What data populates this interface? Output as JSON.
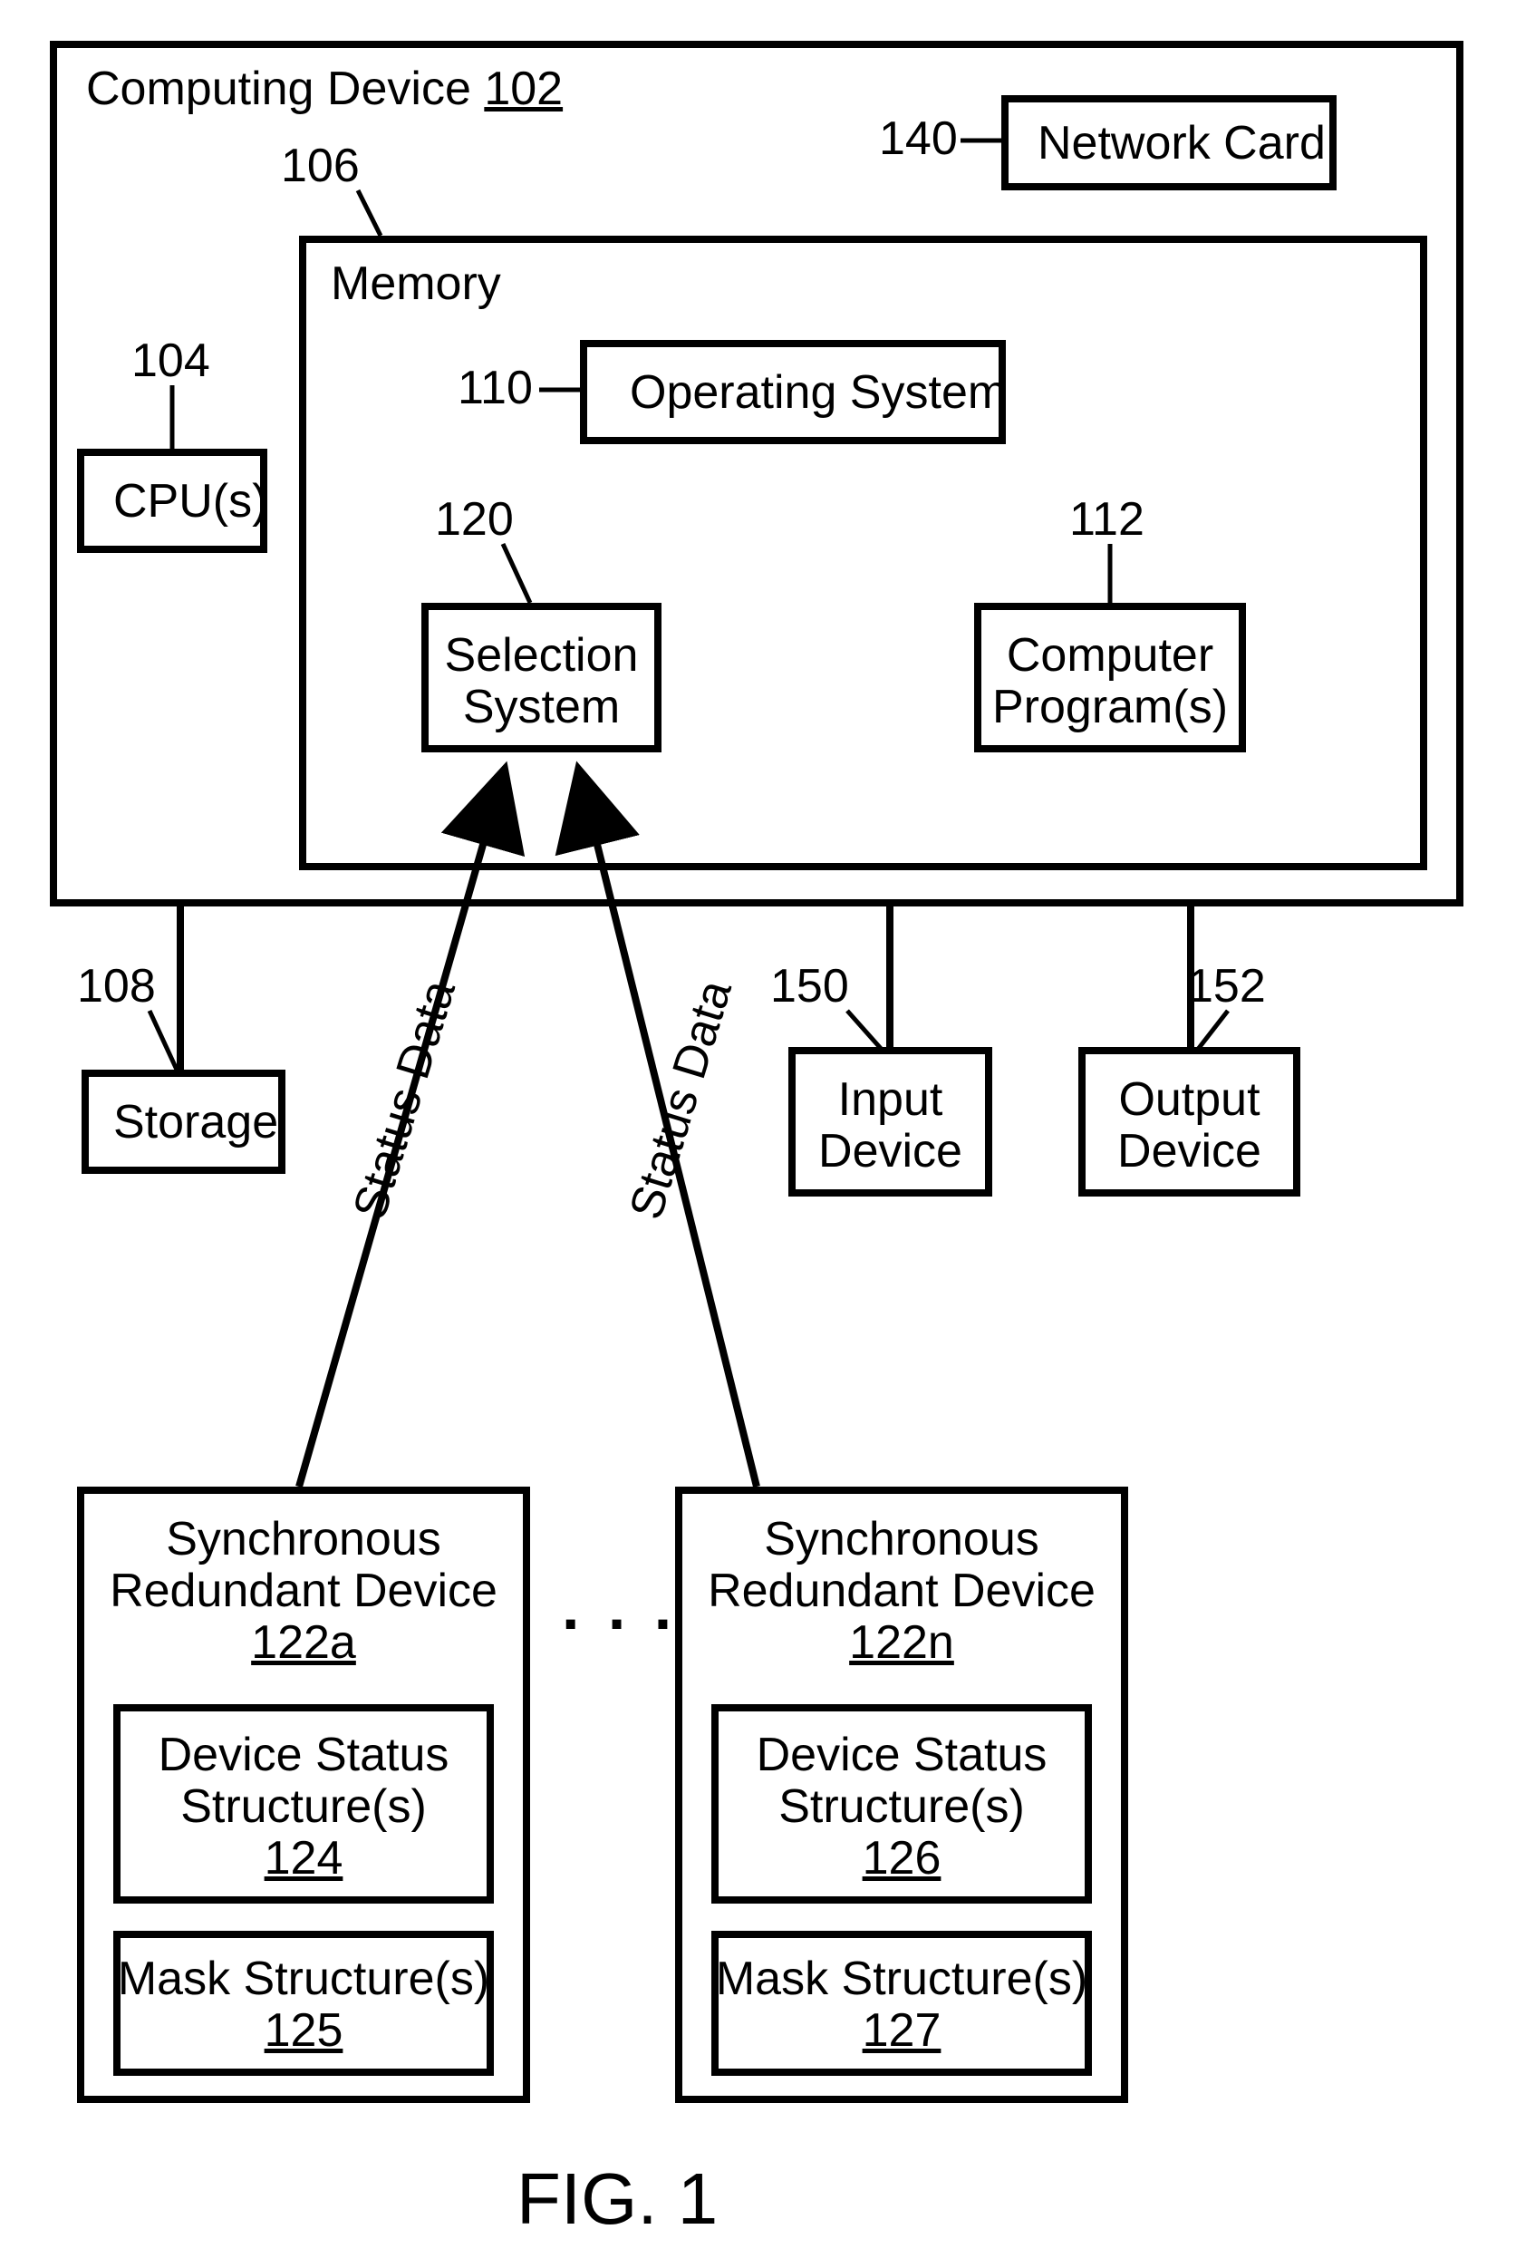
{
  "figure_label": "FIG. 1",
  "computing_device": {
    "title": "Computing Device",
    "ref": "102"
  },
  "network_card": {
    "label": "Network Card",
    "ref": "140"
  },
  "memory": {
    "label": "Memory",
    "ref": "106"
  },
  "cpu": {
    "label": "CPU(s)",
    "ref": "104"
  },
  "os": {
    "label": "Operating System",
    "ref": "110"
  },
  "selection": {
    "line1": "Selection",
    "line2": "System",
    "ref": "120"
  },
  "programs": {
    "line1": "Computer",
    "line2": "Program(s)",
    "ref": "112"
  },
  "storage": {
    "label": "Storage",
    "ref": "108"
  },
  "input": {
    "line1": "Input",
    "line2": "Device",
    "ref": "150"
  },
  "output": {
    "line1": "Output",
    "line2": "Device",
    "ref": "152"
  },
  "status_data_left": "Status Data",
  "status_data_right": "Status Data",
  "ellipsis": ". . .",
  "srd_a": {
    "line1": "Synchronous",
    "line2": "Redundant Device",
    "ref": "122a"
  },
  "srd_n": {
    "line1": "Synchronous",
    "line2": "Redundant Device",
    "ref": "122n"
  },
  "dss_a": {
    "line1": "Device Status",
    "line2": "Structure(s)",
    "ref": "124"
  },
  "dss_n": {
    "line1": "Device Status",
    "line2": "Structure(s)",
    "ref": "126"
  },
  "mask_a": {
    "line1": "Mask Structure(s)",
    "ref": "125"
  },
  "mask_n": {
    "line1": "Mask Structure(s)",
    "ref": "127"
  },
  "chart_data": {
    "type": "block-diagram",
    "title": "FIG. 1",
    "nodes": [
      {
        "id": "102",
        "label": "Computing Device"
      },
      {
        "id": "140",
        "label": "Network Card",
        "parent": "102"
      },
      {
        "id": "106",
        "label": "Memory",
        "parent": "102"
      },
      {
        "id": "104",
        "label": "CPU(s)",
        "parent": "102"
      },
      {
        "id": "110",
        "label": "Operating System",
        "parent": "106"
      },
      {
        "id": "120",
        "label": "Selection System",
        "parent": "106"
      },
      {
        "id": "112",
        "label": "Computer Program(s)",
        "parent": "106"
      },
      {
        "id": "108",
        "label": "Storage"
      },
      {
        "id": "150",
        "label": "Input Device"
      },
      {
        "id": "152",
        "label": "Output Device"
      },
      {
        "id": "122a",
        "label": "Synchronous Redundant Device"
      },
      {
        "id": "124",
        "label": "Device Status Structure(s)",
        "parent": "122a"
      },
      {
        "id": "125",
        "label": "Mask Structure(s)",
        "parent": "122a"
      },
      {
        "id": "122n",
        "label": "Synchronous Redundant Device"
      },
      {
        "id": "126",
        "label": "Device Status Structure(s)",
        "parent": "122n"
      },
      {
        "id": "127",
        "label": "Mask Structure(s)",
        "parent": "122n"
      }
    ],
    "edges": [
      {
        "from": "122a",
        "to": "120",
        "label": "Status Data",
        "directed": true
      },
      {
        "from": "122n",
        "to": "120",
        "label": "Status Data",
        "directed": true
      },
      {
        "from": "108",
        "to": "102",
        "directed": false
      },
      {
        "from": "150",
        "to": "102",
        "directed": false
      },
      {
        "from": "152",
        "to": "102",
        "directed": false
      }
    ],
    "multiplicities": [
      {
        "between": [
          "122a",
          "122n"
        ],
        "notation": "..."
      }
    ]
  }
}
